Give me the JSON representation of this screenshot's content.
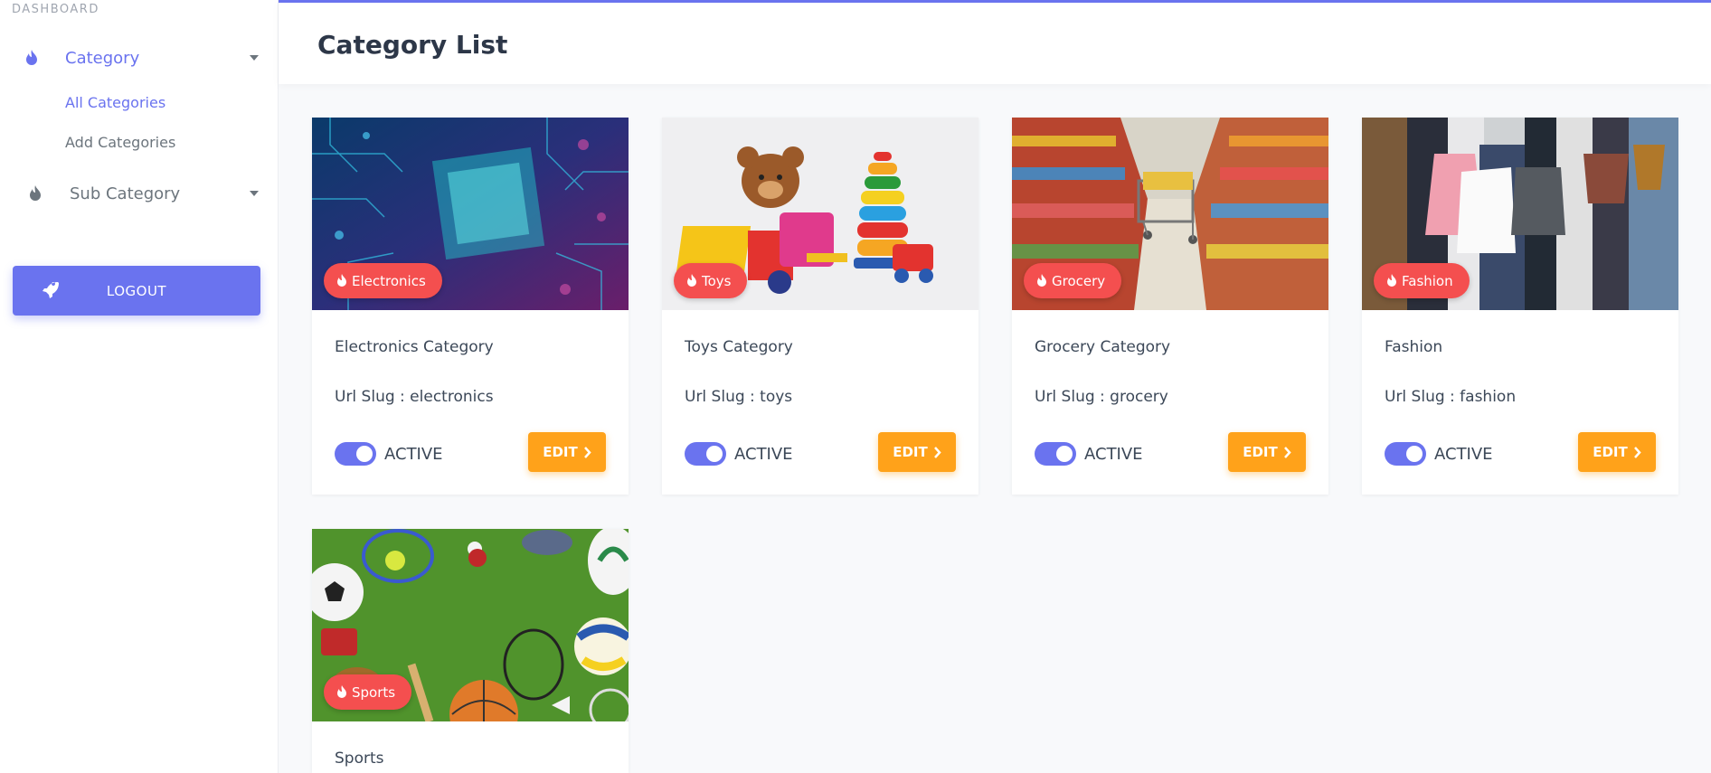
{
  "sidebar": {
    "heading": "DASHBOARD",
    "items": [
      {
        "label": "Category",
        "expanded": true,
        "subitems": [
          {
            "label": "All Categories",
            "active": true
          },
          {
            "label": "Add Categories",
            "active": false
          }
        ]
      },
      {
        "label": "Sub Category",
        "expanded": false
      }
    ],
    "logout_label": "LOGOUT"
  },
  "header": {
    "title": "Category List"
  },
  "cards": [
    {
      "badge": "Electronics",
      "title": "Electronics Category",
      "slug": "Url Slug : electronics",
      "status": "ACTIVE",
      "edit_label": "EDIT",
      "image": "circuit-board"
    },
    {
      "badge": "Toys",
      "title": "Toys Category",
      "slug": "Url Slug : toys",
      "status": "ACTIVE",
      "edit_label": "EDIT",
      "image": "toys"
    },
    {
      "badge": "Grocery",
      "title": "Grocery Category",
      "slug": "Url Slug : grocery",
      "status": "ACTIVE",
      "edit_label": "EDIT",
      "image": "supermarket-aisle"
    },
    {
      "badge": "Fashion",
      "title": "Fashion",
      "slug": "Url Slug : fashion",
      "status": "ACTIVE",
      "edit_label": "EDIT",
      "image": "shopping-bags"
    },
    {
      "badge": "Sports",
      "title": "Sports",
      "image": "sports-equipment"
    }
  ],
  "colors": {
    "accent": "#6a73ef",
    "badge": "#f44f4f",
    "edit": "#ffa21a"
  }
}
